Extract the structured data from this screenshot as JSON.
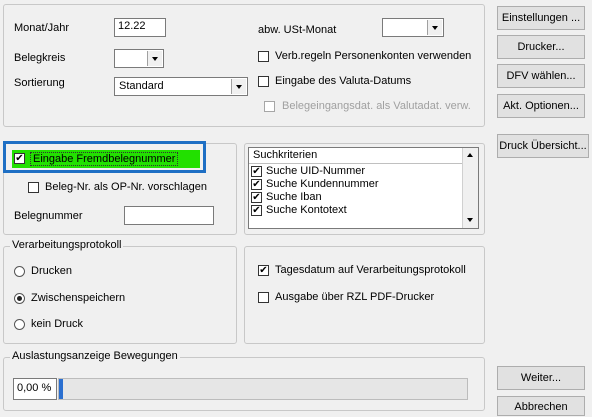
{
  "header": {
    "monat_jahr_label": "Monat/Jahr",
    "monat_jahr_value": "12.22",
    "belegkreis_label": "Belegkreis",
    "belegkreis_value": "",
    "sortierung_label": "Sortierung",
    "sortierung_value": "Standard",
    "abw_ust_label": "abw. USt-Monat",
    "abw_ust_value": "",
    "verb_regeln": {
      "label": "Verb.regeln Personenkonten verwenden",
      "checked": false
    },
    "eingabe_valuta": {
      "label": "Eingabe des Valuta-Datums",
      "checked": false
    },
    "belegeingang": {
      "label": "Belegeingangsdat. als Valutadat. verw.",
      "checked": false,
      "disabled": true
    }
  },
  "fremdbeleg": {
    "eingabe_label": "Eingabe Fremdbelegnummer",
    "eingabe_checked": true,
    "highlight_bg": "#22e000",
    "highlight_border": "#1e6fc4",
    "beleg_nr_label": "Beleg-Nr. als OP-Nr. vorschlagen",
    "beleg_nr_checked": false,
    "belegnummer_label": "Belegnummer",
    "belegnummer_value": ""
  },
  "suchkriterien": {
    "header": "Suchkriterien",
    "items": [
      {
        "label": "Suche UID-Nummer",
        "checked": true
      },
      {
        "label": "Suche Kundennummer",
        "checked": true
      },
      {
        "label": "Suche Iban",
        "checked": true
      },
      {
        "label": "Suche Kontotext",
        "checked": true
      }
    ]
  },
  "verarbeitungsprotokoll": {
    "title": "Verarbeitungsprotokoll",
    "options": [
      {
        "label": "Drucken",
        "selected": false
      },
      {
        "label": "Zwischenspeichern",
        "selected": true
      },
      {
        "label": "kein Druck",
        "selected": false
      }
    ]
  },
  "protokoll_options": {
    "tagesdatum": {
      "label": "Tagesdatum auf Verarbeitungsprotokoll",
      "checked": true
    },
    "ausgabe_rzl": {
      "label": "Ausgabe über RZL PDF-Drucker",
      "checked": false
    }
  },
  "auslastung": {
    "title": "Auslastungsanzeige Bewegungen",
    "percent_label": "0,00 %",
    "progress": 0.01
  },
  "buttons": {
    "einstellungen": "Einstellungen ...",
    "drucker": "Drucker...",
    "dfv": "DFV wählen...",
    "akt_optionen": "Akt. Optionen...",
    "druck_uebersicht": "Druck Übersicht...",
    "weiter": "Weiter...",
    "abbrechen": "Abbrechen"
  }
}
